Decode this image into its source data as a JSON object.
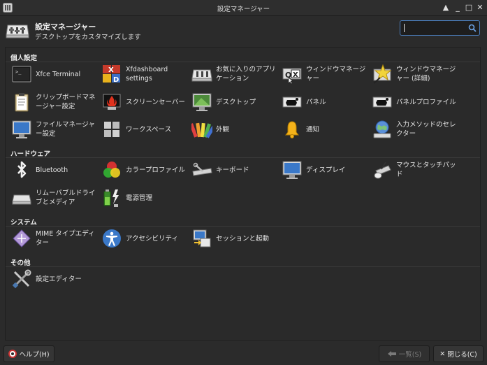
{
  "window": {
    "title": "設定マネージャー",
    "buttons": {
      "up": "▲",
      "minimize": "_",
      "maximize": "□",
      "close": "✕"
    }
  },
  "header": {
    "title": "設定マネージャー",
    "subtitle": "デスクトップをカスタマイズします"
  },
  "search": {
    "value": ""
  },
  "categories": {
    "personal": "個人設定",
    "hardware": "ハードウェア",
    "system": "システム",
    "other": "その他"
  },
  "items": {
    "xfce_terminal": "Xfce Terminal",
    "xfdashboard": "Xfdashboard settings",
    "favorite_apps": "お気に入りのアプリケーション",
    "window_manager": "ウィンドウマネージャー",
    "window_manager_tweaks": "ウィンドウマネージャー (詳細)",
    "clipboard_manager": "クリップボードマネージャー設定",
    "screensaver": "スクリーンセーバー",
    "desktop": "デスクトップ",
    "panel": "パネル",
    "panel_profiles": "パネルプロファイル",
    "file_manager": "ファイルマネージャー設定",
    "workspaces": "ワークスペース",
    "appearance": "外観",
    "notifications": "通知",
    "input_method": "入力メソッドのセレクター",
    "bluetooth": "Bluetooth",
    "color_profiles": "カラープロファイル",
    "keyboard": "キーボード",
    "display": "ディスプレイ",
    "mouse_touchpad": "マウスとタッチパッド",
    "removable_drives": "リムーバブルドライブとメディア",
    "power_manager": "電源管理",
    "mime_editor": "MIME タイプエディター",
    "accessibility": "アクセシビリティ",
    "session_startup": "セッションと起動",
    "settings_editor": "設定エディター"
  },
  "footer": {
    "help": "ヘルプ(H)",
    "all": "一覧(S)",
    "close": "閉じる(C)"
  }
}
